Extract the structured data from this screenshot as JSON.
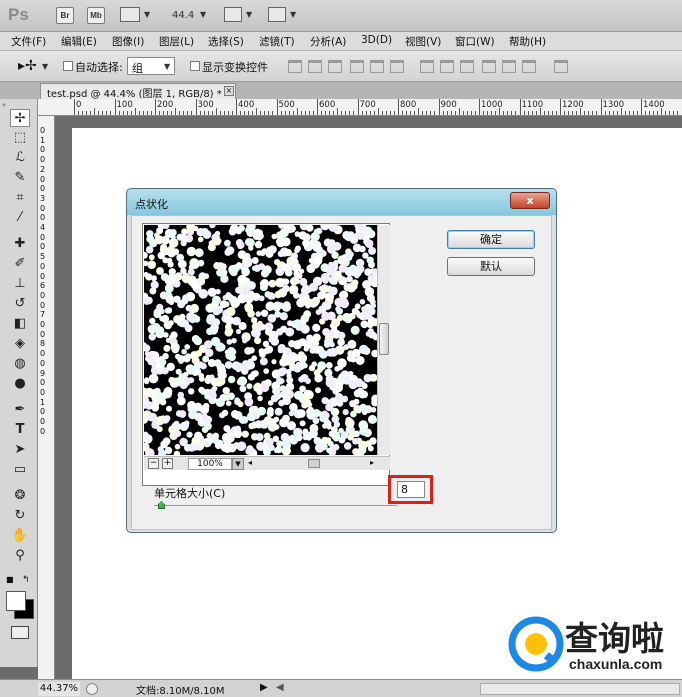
{
  "appbar": {
    "logo": "Ps",
    "bridge_label": "Br",
    "minibridge_label": "Mb",
    "zoom_value": "44.4"
  },
  "menu": [
    "文件(F)",
    "编辑(E)",
    "图像(I)",
    "图层(L)",
    "选择(S)",
    "滤镜(T)",
    "分析(A)",
    "3D(D)",
    "视图(V)",
    "窗口(W)",
    "帮助(H)"
  ],
  "options": {
    "auto_select_label": "自动选择:",
    "auto_select_value": "组",
    "show_transform_label": "显示变换控件"
  },
  "document_tab": {
    "title": "test.psd @ 44.4% (图层 1, RGB/8) *",
    "close": "×"
  },
  "ruler_top": [
    "0",
    "100",
    "200",
    "300",
    "400",
    "500",
    "600",
    "700",
    "800",
    "900",
    "1000",
    "1100",
    "1200",
    "1300",
    "1400"
  ],
  "ruler_left": [
    "0",
    "1",
    "0",
    "0",
    "2",
    "0",
    "0",
    "3",
    "0",
    "0",
    "4",
    "0",
    "0",
    "5",
    "0",
    "0",
    "6",
    "0",
    "0",
    "7",
    "0",
    "0",
    "8",
    "0",
    "0",
    "9",
    "0",
    "0",
    "1",
    "0",
    "0",
    "0"
  ],
  "dialog": {
    "title": "点状化",
    "close": "x",
    "ok": "确定",
    "default": "默认",
    "zoom_minus": "−",
    "zoom_plus": "+",
    "zoom_value": "100%",
    "cell_size_label": "单元格大小(C)",
    "cell_size_value": "8",
    "cell_size_slider": 0.02
  },
  "status": {
    "zoom": "44.37%",
    "doc_size": "文档:8.10M/8.10M"
  },
  "watermark": {
    "brand": "查询啦",
    "url": "chaxunla.com"
  },
  "colors": {
    "dialog_title": "#9fd6e8",
    "highlight_box": "#d9201b",
    "watermark_blue": "#1e88e5"
  }
}
